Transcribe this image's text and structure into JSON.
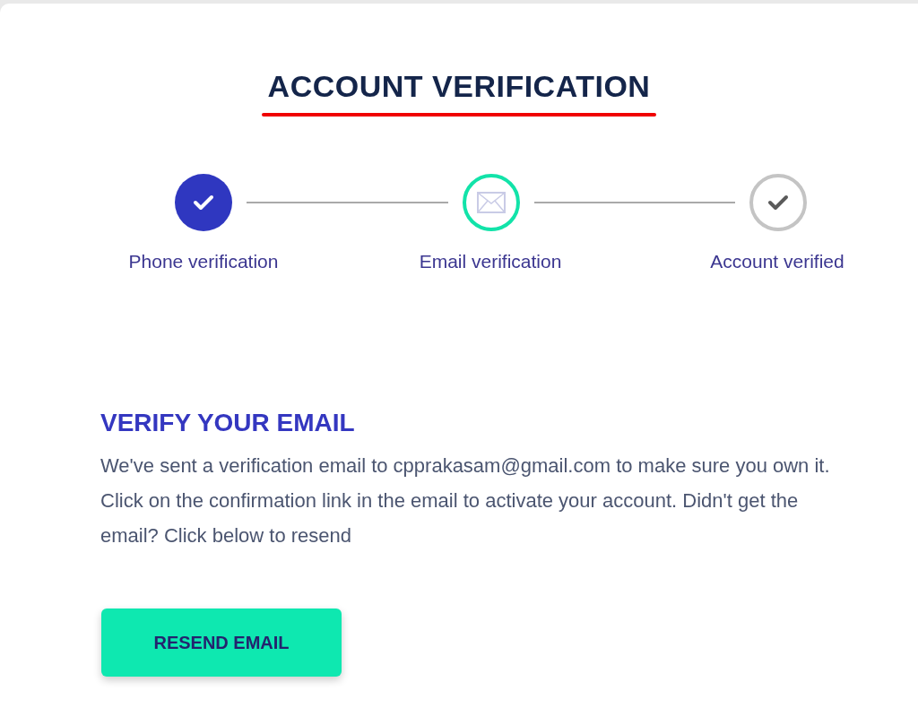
{
  "title": "ACCOUNT VERIFICATION",
  "steps": [
    {
      "label": "Phone verification",
      "kind": "done"
    },
    {
      "label": "Email verification",
      "kind": "current"
    },
    {
      "label": "Account verified",
      "kind": "pending"
    }
  ],
  "heading": "VERIFY YOUR EMAIL",
  "message": "We've sent a verification email to cpprakasam@gmail.com to make sure you own it. Click on the confirmation link in the email to activate your account. Didn't get the email? Click below to resend",
  "button": "RESEND EMAIL"
}
